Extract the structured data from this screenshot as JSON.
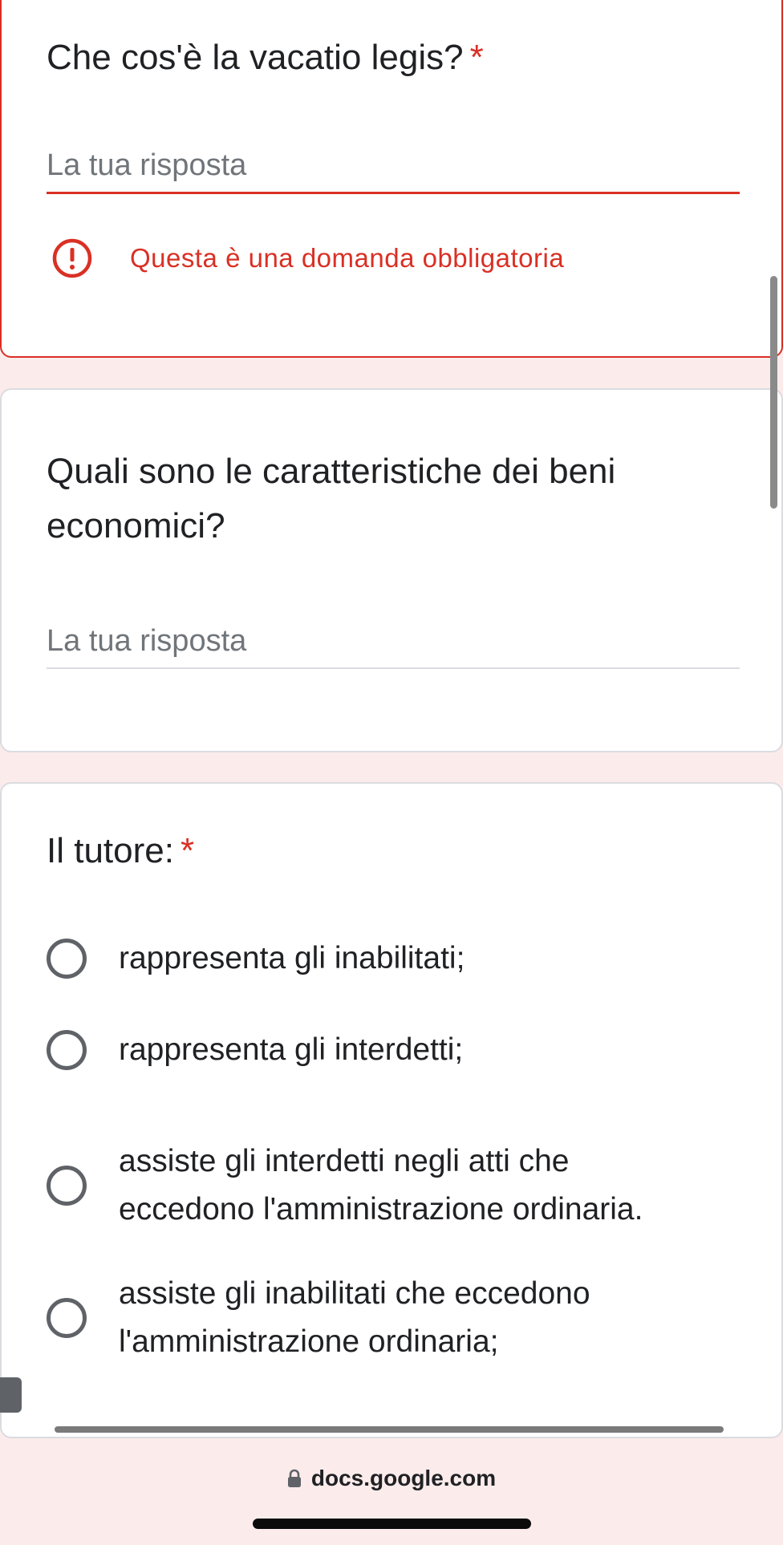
{
  "questions": [
    {
      "title": "Che cos'è la vacatio legis?",
      "required_mark": "*",
      "answer_placeholder": "La tua risposta",
      "error_message": "Questa è una domanda obbligatoria"
    },
    {
      "title_line1": "Quali sono le caratteristiche dei beni",
      "title_line2": "economici?",
      "answer_placeholder": "La tua risposta"
    },
    {
      "title": "Il tutore:",
      "required_mark": "*",
      "options": [
        {
          "line1": "rappresenta gli inabilitati;"
        },
        {
          "line1": "rappresenta gli interdetti;"
        },
        {
          "line1": "assiste gli interdetti negli atti che",
          "line2": "eccedono l'amministrazione ordinaria."
        },
        {
          "line1": "assiste gli inabilitati che eccedono",
          "line2": "l'amministrazione ordinaria;"
        }
      ]
    }
  ],
  "browser": {
    "url": "docs.google.com"
  },
  "icons": {
    "error": "alert-circle-icon",
    "lock": "lock-icon"
  },
  "colors": {
    "error": "#d93025",
    "page_background": "#fbeceb",
    "radio_border": "#5f6368"
  }
}
